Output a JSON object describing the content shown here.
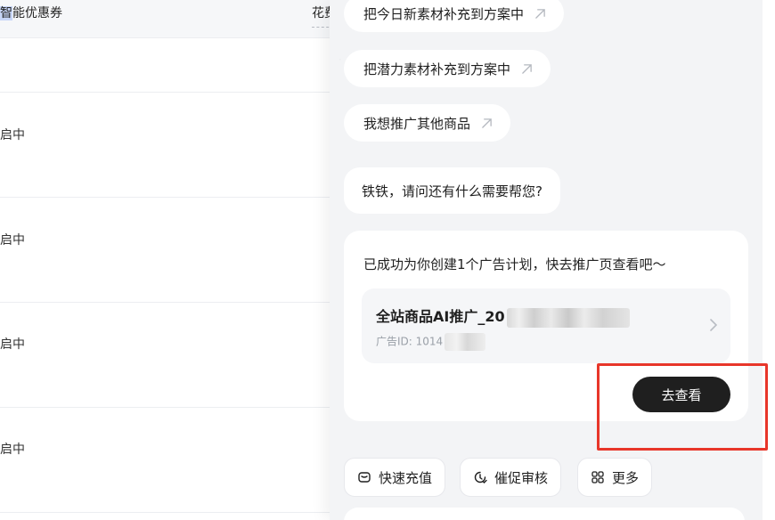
{
  "table": {
    "header": {
      "col1_highlight": "智",
      "col1_rest": "能优惠券",
      "col2": "花费"
    },
    "rows": [
      {
        "status": "开启中"
      },
      {
        "status": "开启中"
      },
      {
        "status": "开启中"
      },
      {
        "status": "开启中"
      }
    ]
  },
  "chat": {
    "suggestions": [
      {
        "label": "把今日新素材补充到方案中",
        "icon": "arrow-up-right-icon"
      },
      {
        "label": "把潜力素材补充到方案中",
        "icon": "arrow-up-right-icon"
      },
      {
        "label": "我想推广其他商品",
        "icon": "arrow-up-right-icon"
      }
    ],
    "ask_text": "铁铁，请问还有什么需要帮您?",
    "card": {
      "message": "已成功为你创建1个广告计划，快去推广页查看吧～",
      "plan_name": "全站商品AI推广_20",
      "plan_id_label": "广告ID: 1014",
      "view_button": "去查看"
    },
    "actions": [
      {
        "label": "快速充值",
        "icon": "wallet-icon"
      },
      {
        "label": "催促审核",
        "icon": "clock-check-icon"
      },
      {
        "label": "更多",
        "icon": "grid-icon"
      }
    ]
  },
  "colors": {
    "panel_bg": "#f3f4f6",
    "button_dark": "#1f1f1f",
    "annotation_red": "#e8362a"
  }
}
